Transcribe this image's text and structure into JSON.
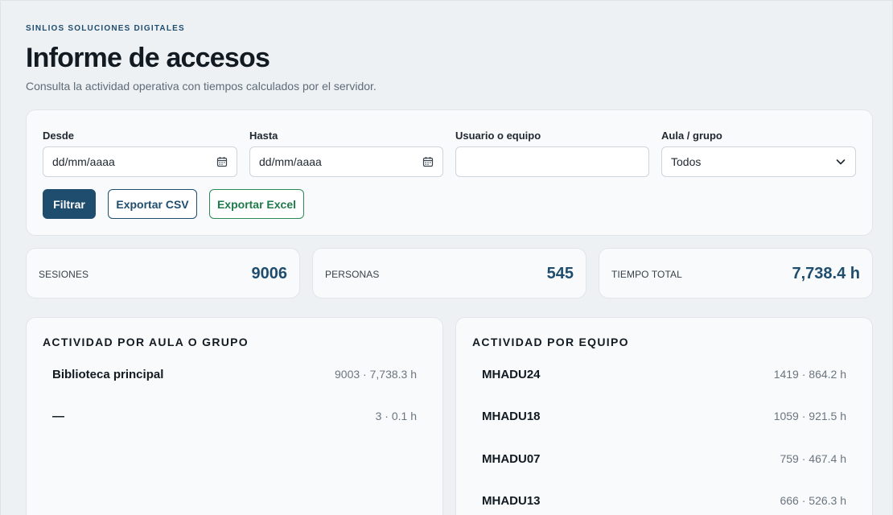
{
  "header": {
    "brand": "SINLIOS SOLUCIONES DIGITALES",
    "title": "Informe de accesos",
    "subtitle": "Consulta la actividad operativa con tiempos calculados por el servidor."
  },
  "filters": {
    "desde": {
      "label": "Desde",
      "placeholder": "dd/mm/aaaa"
    },
    "hasta": {
      "label": "Hasta",
      "placeholder": "dd/mm/aaaa"
    },
    "usuario": {
      "label": "Usuario o equipo",
      "value": ""
    },
    "aula": {
      "label": "Aula / grupo",
      "selected": "Todos"
    },
    "buttons": {
      "filter": "Filtrar",
      "csv": "Exportar CSV",
      "excel": "Exportar Excel"
    }
  },
  "stats": [
    {
      "label": "SESIONES",
      "value": "9006"
    },
    {
      "label": "PERSONAS",
      "value": "545"
    },
    {
      "label": "TIEMPO TOTAL",
      "value": "7,738.4 h"
    }
  ],
  "aulas": {
    "title": "ACTIVIDAD POR AULA O GRUPO",
    "rows": [
      {
        "name": "Biblioteca principal",
        "value": "9003 · 7,738.3 h"
      },
      {
        "name": "—",
        "value": "3 · 0.1 h"
      }
    ]
  },
  "equipos": {
    "title": "ACTIVIDAD POR EQUIPO",
    "rows": [
      {
        "name": "MHADU24",
        "value": "1419 · 864.2 h"
      },
      {
        "name": "MHADU18",
        "value": "1059 · 921.5 h"
      },
      {
        "name": "MHADU07",
        "value": "759 · 467.4 h"
      },
      {
        "name": "MHADU13",
        "value": "666 · 526.3 h"
      }
    ]
  },
  "colors": {
    "accent": "#1f4d6e",
    "excel": "#1e7a4a",
    "background": "#eef1f4"
  }
}
